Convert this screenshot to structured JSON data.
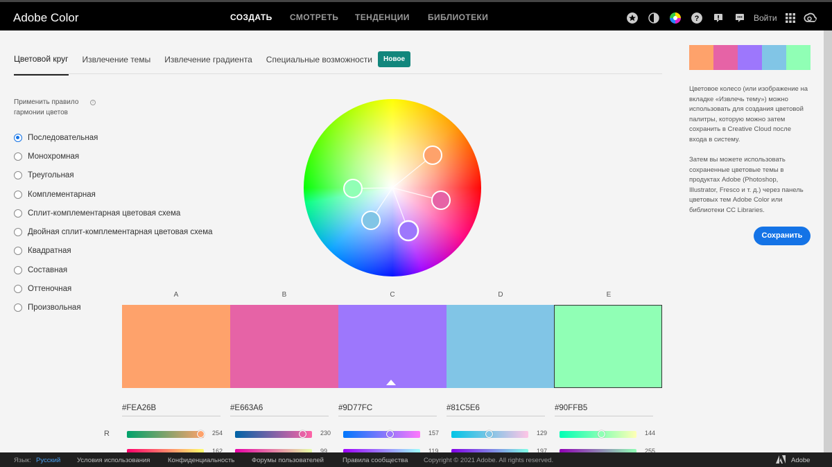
{
  "header": {
    "logo": "Adobe Color",
    "nav": [
      "СОЗДАТЬ",
      "СМОТРЕТЬ",
      "ТЕНДЕНЦИИ",
      "БИБЛИОТЕКИ"
    ],
    "icons": [
      "star-icon",
      "contrast-icon",
      "color-wheel-icon",
      "help-icon",
      "alert-icon",
      "chat-icon"
    ],
    "login": "Войти"
  },
  "tabs": {
    "items": [
      "Цветовой круг",
      "Извлечение темы",
      "Извлечение градиента",
      "Специальные возможности"
    ],
    "badge": "Новое"
  },
  "harmony": {
    "title": "Применить правило гармонии цветов",
    "info_icon": "info-icon",
    "rules": [
      "Последовательная",
      "Монохромная",
      "Треугольная",
      "Комплементарная",
      "Сплит-комплементарная цветовая схема",
      "Двойная сплит-комплементарная цветовая схема",
      "Квадратная",
      "Составная",
      "Оттеночная",
      "Произвольная"
    ],
    "selected": "Последовательная"
  },
  "palette": {
    "letters": [
      "A",
      "B",
      "C",
      "D",
      "E"
    ],
    "hex": [
      "#FEA26B",
      "#E663A6",
      "#9D77FC",
      "#81C5E6",
      "#90FFB5"
    ],
    "colors": [
      "#fea26b",
      "#e663a6",
      "#9d77fc",
      "#81c5e6",
      "#90ffb5"
    ],
    "r_label": "R",
    "r_values": [
      "254",
      "230",
      "157",
      "129",
      "144"
    ],
    "g_values": [
      "162",
      "99",
      "119",
      "197",
      "255"
    ]
  },
  "sidebar": {
    "desc1": "Цветовое колесо (или изображение на вкладке «Извлечь тему») можно использовать для создания цветовой палитры, которую можно затем сохранить в Creative Cloud после входа в систему.",
    "desc2": "Затем вы можете использовать сохраненные цветовые темы в продуктах Adobe (Photoshop, Illustrator, Fresco и т. д.) через панель цветовых тем Adobe Color или библиотеки CC Libraries.",
    "save": "Сохранить"
  },
  "footer": {
    "lang_label": "Язык:",
    "lang_value": "Русский",
    "links": [
      "Условия использования",
      "Конфиденциальность",
      "Форумы пользователей",
      "Правила сообщества"
    ],
    "copyright": "Copyright © 2021 Adobe. All rights reserved.",
    "brand": "Adobe"
  }
}
